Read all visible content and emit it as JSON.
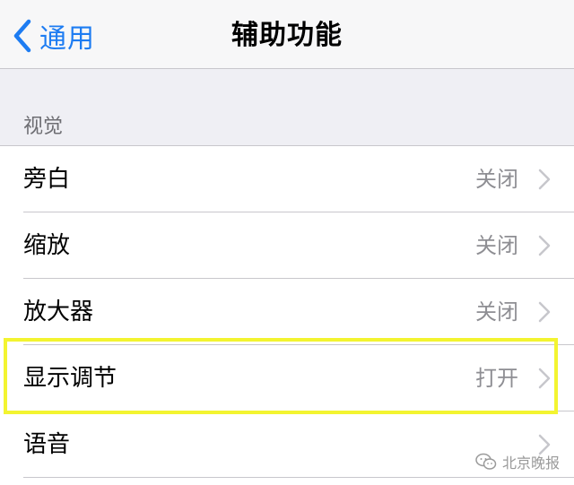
{
  "navbar": {
    "back_label": "通用",
    "title": "辅助功能"
  },
  "section": {
    "header": "视觉"
  },
  "rows": [
    {
      "label": "旁白",
      "value": "关闭"
    },
    {
      "label": "缩放",
      "value": "关闭"
    },
    {
      "label": "放大器",
      "value": "关闭"
    },
    {
      "label": "显示调节",
      "value": "打开"
    },
    {
      "label": "语音",
      "value": ""
    }
  ],
  "watermark": {
    "text": "北京晚报",
    "icon": "wechat-icon"
  },
  "colors": {
    "accent": "#1d7cf2",
    "highlight": "#f3f430",
    "secondary_text": "#8e8e93",
    "group_background": "#efeff4"
  }
}
